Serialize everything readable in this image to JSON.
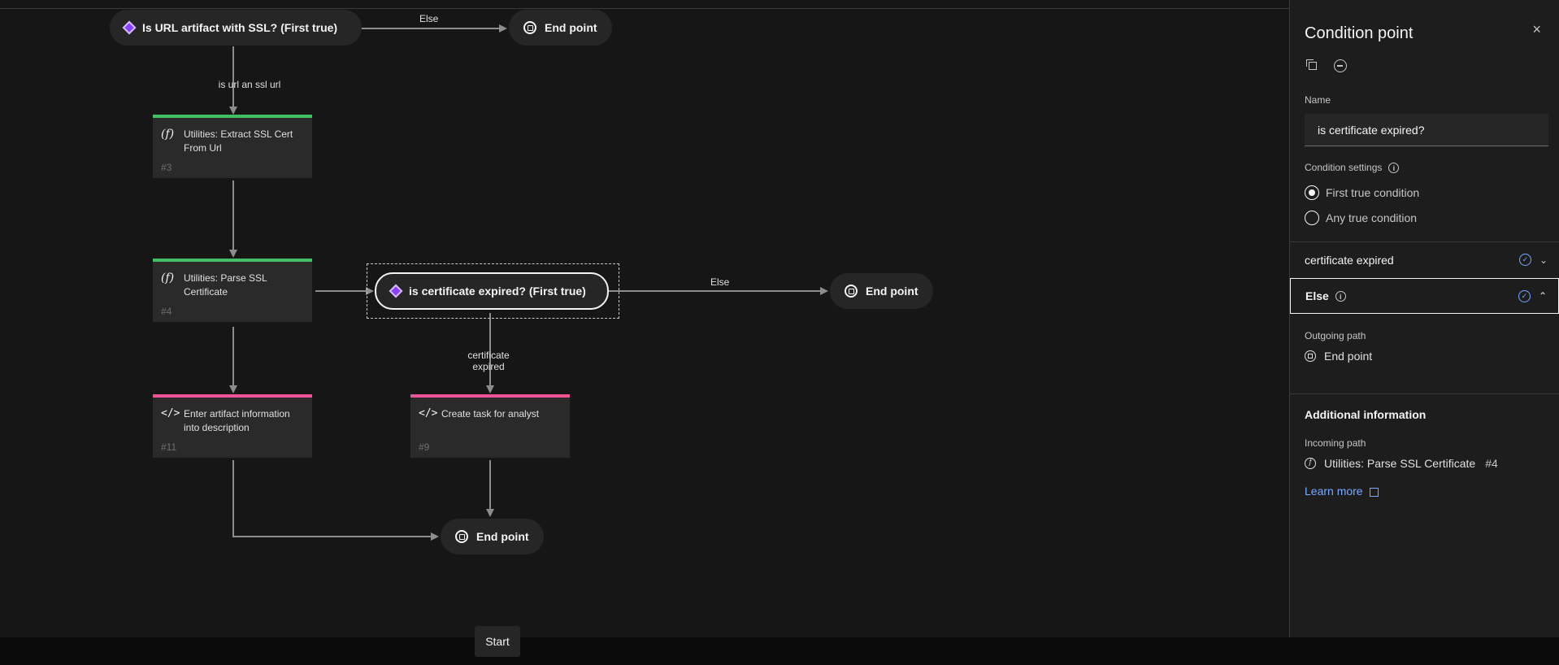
{
  "canvas": {
    "nodes": {
      "cond_url_ssl": "Is URL artifact with SSL? (First true)",
      "end_top": "End point",
      "task_extract": {
        "label": "Utilities: Extract SSL Cert From Url",
        "number": "#3"
      },
      "task_parse": {
        "label": "Utilities: Parse SSL Certificate",
        "number": "#4"
      },
      "cond_expired": "is certificate expired? (First true)",
      "end_middle": "End point",
      "task_enter": {
        "label": "Enter artifact information into description",
        "number": "#11"
      },
      "task_create": {
        "label": "Create task for analyst",
        "number": "#9"
      },
      "end_bottom": "End point"
    },
    "edge_labels": {
      "else_top": "Else",
      "ssl_url": "is url an ssl url",
      "else_middle": "Else",
      "cert_expired": "certificate expired"
    },
    "start_button": "Start",
    "colors": {
      "function_bar": "#42be65",
      "script_bar": "#ee5396",
      "condition_diamond": "#8a3ffc",
      "link": "#78a9ff"
    }
  },
  "panel": {
    "title": "Condition point",
    "close_icon": "×",
    "name_label": "Name",
    "name_value": "is certificate expired?",
    "settings_label": "Condition settings",
    "radio_options": [
      {
        "label": "First true condition",
        "checked": true
      },
      {
        "label": "Any true condition",
        "checked": false
      }
    ],
    "conditions": [
      {
        "label": "certificate expired",
        "expanded": false
      },
      {
        "label": "Else",
        "expanded": true
      }
    ],
    "outgoing_label": "Outgoing path",
    "outgoing_value": "End point",
    "additional_title": "Additional information",
    "incoming_label": "Incoming path",
    "incoming_value": "Utilities: Parse SSL Certificate",
    "incoming_number": "#4",
    "learn_more": "Learn more"
  }
}
